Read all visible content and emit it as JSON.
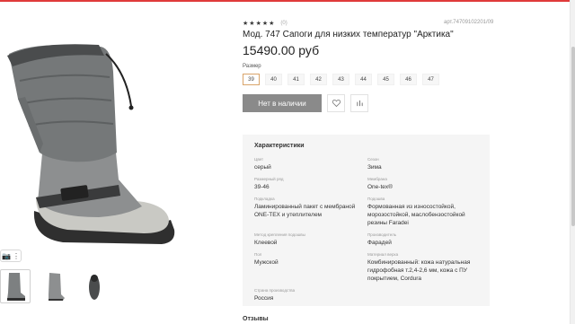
{
  "product": {
    "rating_stars": [
      "★",
      "★",
      "★",
      "★",
      "★"
    ],
    "review_count": "(0)",
    "article": "арт.74709102201/09",
    "title": "Мод. 747 Сапоги для низких температур \"Арктика\"",
    "price": "15490.00 руб"
  },
  "gallery": {
    "tools": [
      "📷",
      "⋮"
    ],
    "thumb_count": 3
  },
  "sizes": {
    "label": "Размер",
    "options": [
      "39",
      "40",
      "41",
      "42",
      "43",
      "44",
      "45",
      "46",
      "47"
    ],
    "selected": "39"
  },
  "actions": {
    "stock_label": "Нет в наличии",
    "favorite_icon": "heart-icon",
    "compare_icon": "compare-icon"
  },
  "specs": {
    "heading": "Характеристики",
    "items": [
      {
        "key": "Цвет",
        "value": "серый"
      },
      {
        "key": "Сезон",
        "value": "Зима"
      },
      {
        "key": "Размерный ряд",
        "value": "39-46"
      },
      {
        "key": "Мембрана",
        "value": "One-tex®"
      },
      {
        "key": "Подкладка",
        "value": "Ламинированный пакет с мембраной ONE-TEX и утеплителем"
      },
      {
        "key": "Подошва",
        "value": "Формованная из износостойкой, морозостойкой, маслобензостойкой резины Faradei"
      },
      {
        "key": "Метод крепления подошвы",
        "value": "Клеевой"
      },
      {
        "key": "Производитель",
        "value": "Фарадей"
      },
      {
        "key": "Пол",
        "value": "Мужской"
      },
      {
        "key": "Материал верха",
        "value": "Комбинированный: кожа натуральная гидрофобная т.2,4-2,6 мм, кожа с ПУ покрытием, Cordura"
      },
      {
        "key": "Страна производства",
        "value": "Россия"
      }
    ]
  },
  "reviews_heading": "Отзывы",
  "colors": {
    "accent_border": "#d9a46a",
    "button_bg": "#8a8a8a",
    "panel_bg": "#f5f5f5"
  }
}
